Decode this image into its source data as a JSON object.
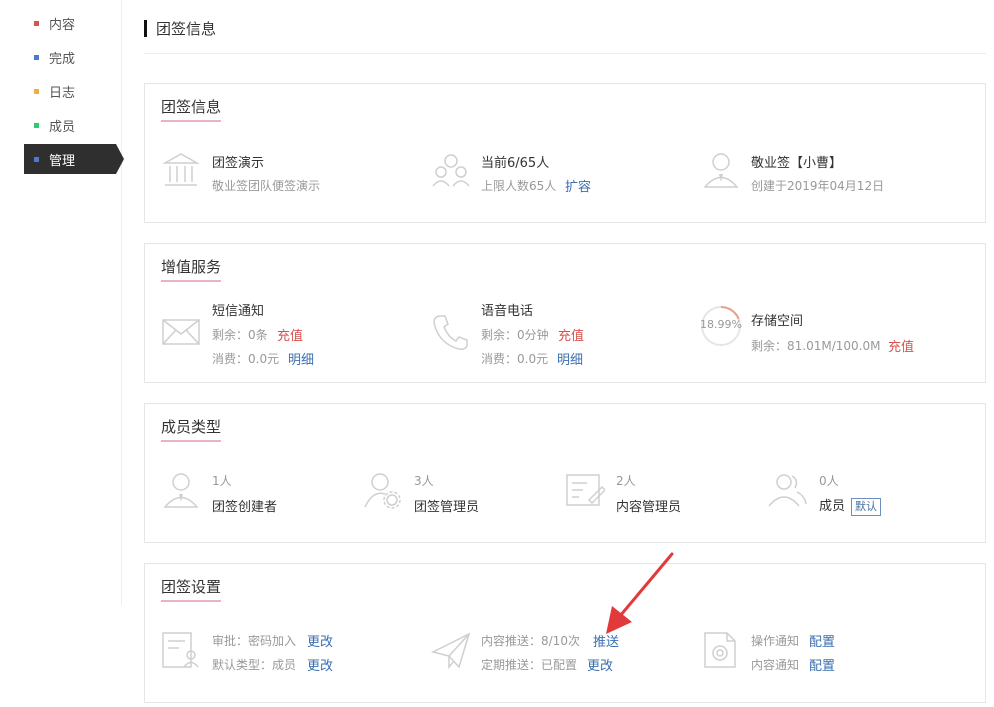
{
  "sidebar": {
    "items": [
      {
        "label": "内容",
        "color": "#d9534f"
      },
      {
        "label": "完成",
        "color": "#4a7bd0"
      },
      {
        "label": "日志",
        "color": "#f0ad4e"
      },
      {
        "label": "成员",
        "color": "#2ecc71"
      },
      {
        "label": "管理",
        "color": "#4a7bd0"
      }
    ],
    "active_index": 4
  },
  "header": {
    "title": "团签信息"
  },
  "info_card": {
    "title": "团签信息",
    "team": {
      "name": "团签演示",
      "desc": "敬业签团队便签演示"
    },
    "members": {
      "count": "当前6/65人",
      "limit": "上限人数65人",
      "expand": "扩容"
    },
    "owner": {
      "name": "敬业签【小曹】",
      "created": "创建于2019年04月12日"
    }
  },
  "value_card": {
    "title": "增值服务",
    "sms": {
      "name": "短信通知",
      "remain_label": "剩余：0条",
      "recharge": "充值",
      "cost_label": "消费：0.0元",
      "detail": "明细"
    },
    "voice": {
      "name": "语音电话",
      "remain_label": "剩余：0分钟",
      "recharge": "充值",
      "cost_label": "消费：0.0元",
      "detail": "明细"
    },
    "storage": {
      "name": "存储空间",
      "percent_text": "18.99%",
      "percent": 18.99,
      "remain_label": "剩余：81.01M/100.0M",
      "recharge": "充值"
    }
  },
  "member_card": {
    "title": "成员类型",
    "types": [
      {
        "count": "1人",
        "name": "团签创建者"
      },
      {
        "count": "3人",
        "name": "团签管理员"
      },
      {
        "count": "2人",
        "name": "内容管理员"
      },
      {
        "count": "0人",
        "name": "成员",
        "tag": "默认"
      }
    ]
  },
  "settings_card": {
    "title": "团签设置",
    "approval": {
      "label": "审批：密码加入",
      "edit": "更改"
    },
    "default_type": {
      "label": "默认类型：成员",
      "edit": "更改"
    },
    "push": {
      "label": "内容推送：8/10次",
      "action": "推送"
    },
    "scheduled": {
      "label": "定期推送：已配置",
      "edit": "更改"
    },
    "op_notice": {
      "label": "操作通知",
      "config": "配置"
    },
    "content_notice": {
      "label": "内容通知",
      "config": "配置"
    }
  }
}
